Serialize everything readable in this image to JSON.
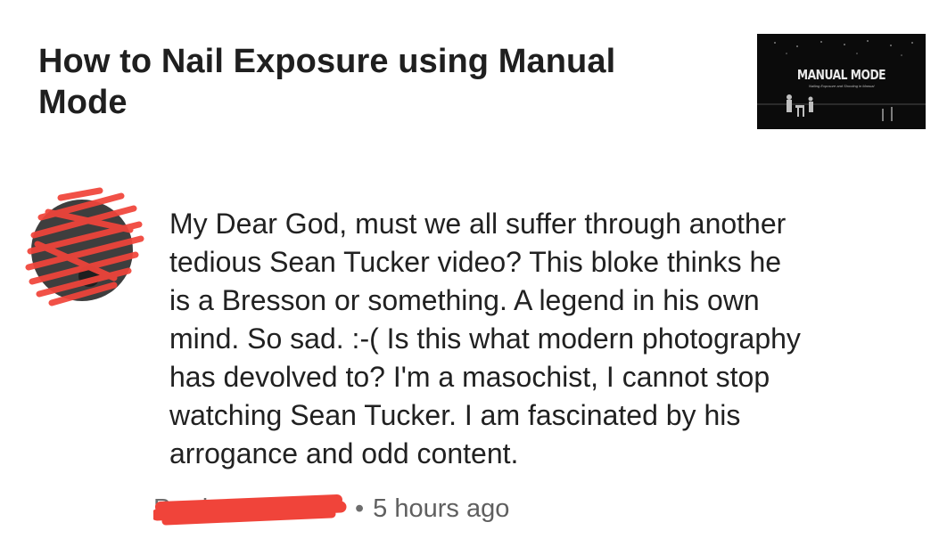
{
  "video": {
    "title": "How to Nail Exposure using Manual Mode",
    "thumbnail_title": "MANUAL MODE",
    "thumbnail_subtitle": "Nailing Exposure and Shooting in Manual"
  },
  "comment": {
    "text": "My Dear God, must we all suffer through another\ntedious Sean Tucker video?  This bloke thinks he\nis a Bresson or something.  A legend in his own\nmind. So sad. :-(  Is this what modern photography\nhas devolved to?  I'm a masochist, I cannot stop\nwatching Sean Tucker. I am fascinated by his\narrogance and odd content.",
    "author_visible": "Parden Carter",
    "separator": "•",
    "timestamp": "5 hours ago"
  },
  "colors": {
    "redaction": "#f0443a",
    "text": "#212121",
    "meta": "#5f5f5f",
    "thumbnail_bg": "#0b0b0b"
  },
  "icons": {
    "avatar": "redacted-avatar",
    "thumbnail": "video-thumbnail"
  }
}
